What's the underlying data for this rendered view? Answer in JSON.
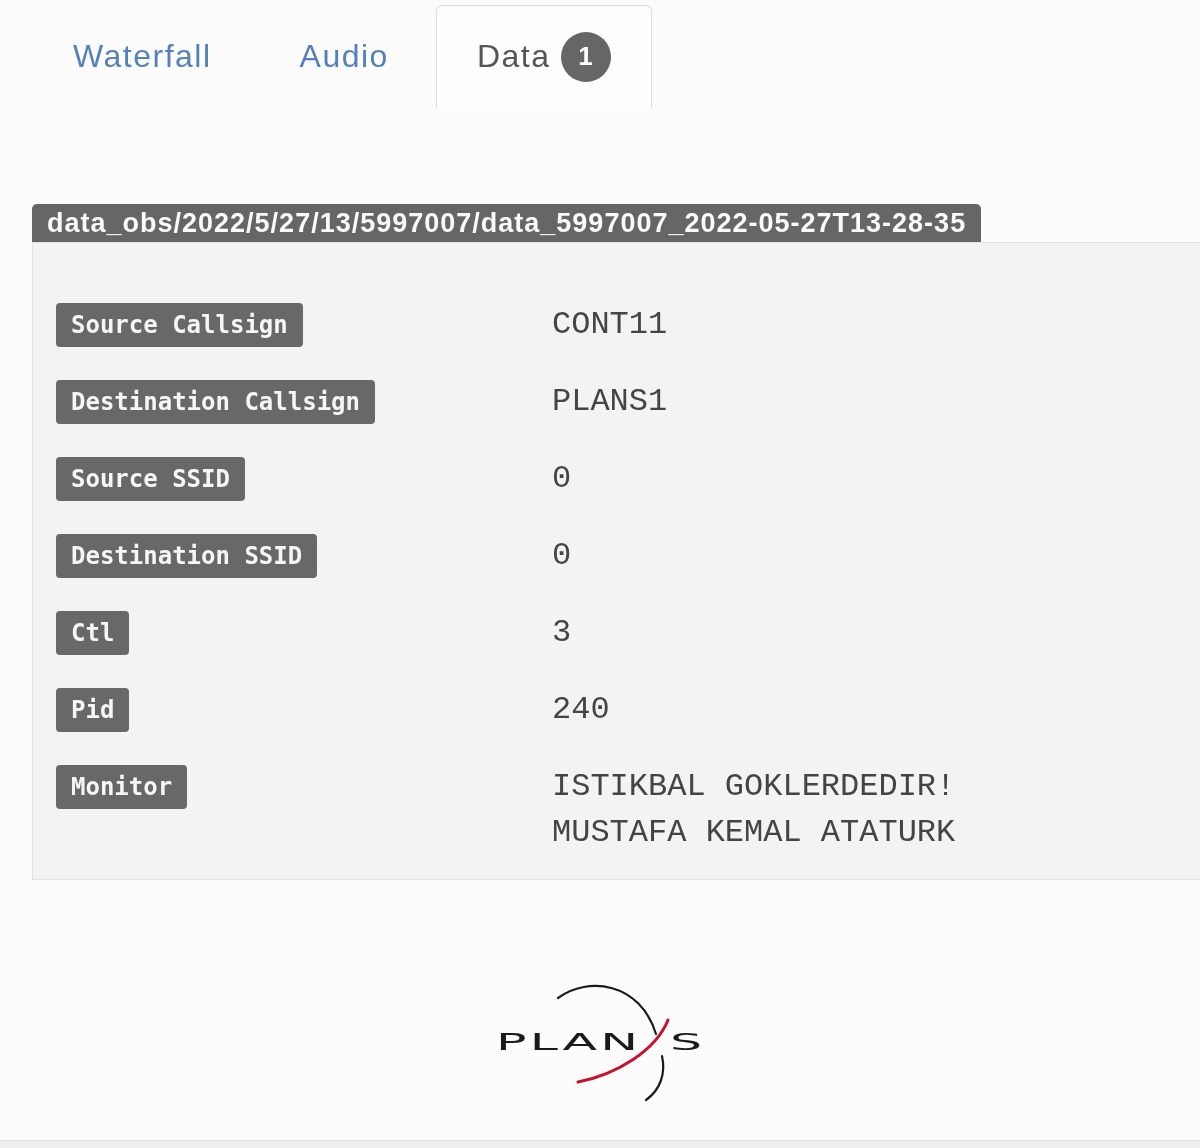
{
  "tabs": [
    {
      "label": "Waterfall",
      "selected": false
    },
    {
      "label": "Audio",
      "selected": false
    },
    {
      "label": "Data",
      "selected": true,
      "badge": "1"
    }
  ],
  "file_path": "data_obs/2022/5/27/13/5997007/data_5997007_2022-05-27T13-28-35",
  "fields": [
    {
      "label": "Source Callsign",
      "value": "CONT11"
    },
    {
      "label": "Destination Callsign",
      "value": "PLANS1"
    },
    {
      "label": "Source SSID",
      "value": "0"
    },
    {
      "label": "Destination SSID",
      "value": "0"
    },
    {
      "label": "Ctl",
      "value": "3"
    },
    {
      "label": "Pid",
      "value": "240"
    },
    {
      "label": "Monitor",
      "value": "ISTIKBAL GOKLERDEDIR!\nMUSTAFA KEMAL ATATURK"
    }
  ],
  "logo": {
    "text_1": "PLAN",
    "text_2": "S"
  }
}
